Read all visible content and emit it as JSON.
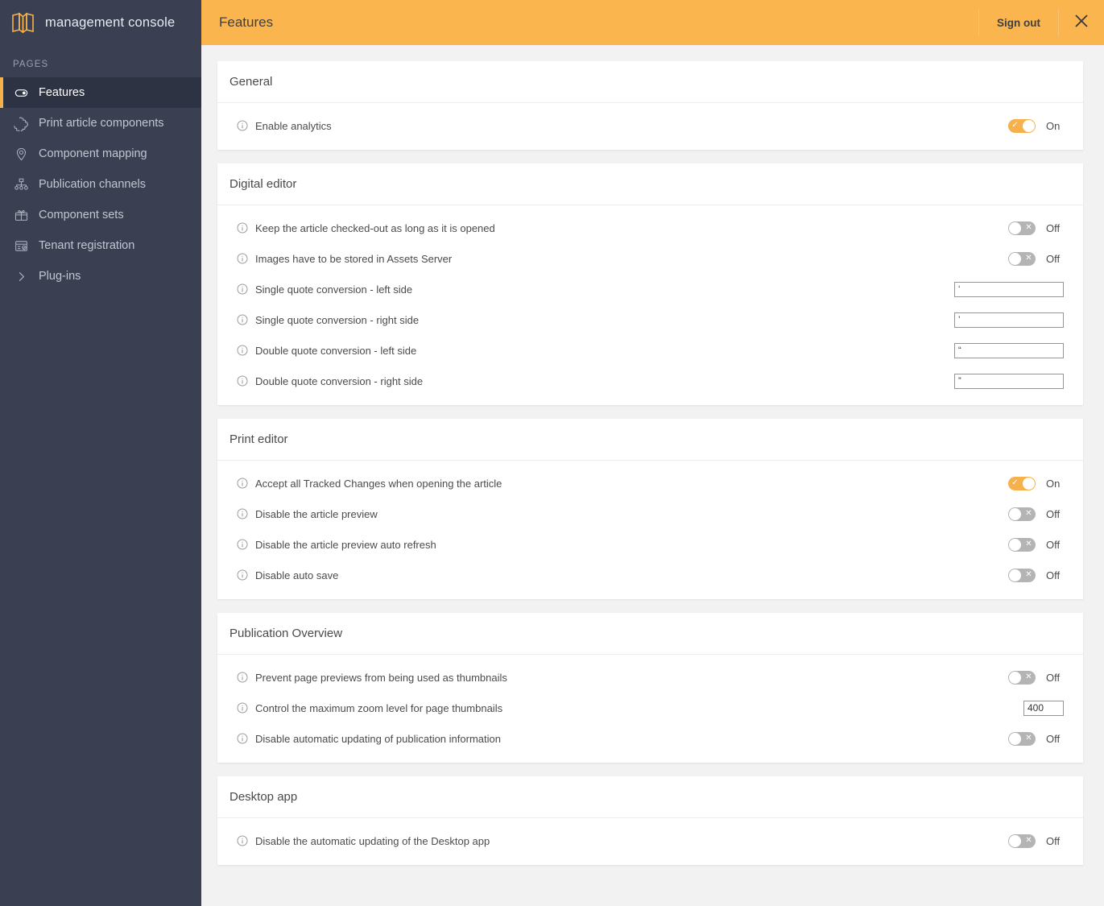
{
  "brand": {
    "title": "management console",
    "logo_icon": "book-logo-icon"
  },
  "sidebar": {
    "section_label": "PAGES",
    "items": [
      {
        "label": "Features",
        "icon": "toggle-icon",
        "active": true
      },
      {
        "label": "Print article components",
        "icon": "puzzle-icon",
        "active": false
      },
      {
        "label": "Component mapping",
        "icon": "map-pin-icon",
        "active": false
      },
      {
        "label": "Publication channels",
        "icon": "sitemap-icon",
        "active": false
      },
      {
        "label": "Component sets",
        "icon": "box-icon",
        "active": false
      },
      {
        "label": "Tenant registration",
        "icon": "registration-icon",
        "active": false
      },
      {
        "label": "Plug-ins",
        "icon": "chevron-right-icon",
        "active": false
      }
    ]
  },
  "topbar": {
    "title": "Features",
    "signout_label": "Sign out",
    "close_icon": "close-icon"
  },
  "colors": {
    "accent": "#fbb54f",
    "toggle_on": "#f7b14c",
    "toggle_off": "#b4b4b4",
    "sidebar_bg": "#3a4052",
    "sidebar_active_bg": "#2d3342",
    "page_bg": "#f2f2f2"
  },
  "states": {
    "on": "On",
    "off": "Off"
  },
  "sections": [
    {
      "title": "General",
      "rows": [
        {
          "label": "Enable analytics",
          "type": "toggle",
          "value": "On"
        }
      ]
    },
    {
      "title": "Digital editor",
      "rows": [
        {
          "label": "Keep the article checked-out as long as it is opened",
          "type": "toggle",
          "value": "Off"
        },
        {
          "label": "Images have to be stored in Assets Server",
          "type": "toggle",
          "value": "Off"
        },
        {
          "label": "Single quote conversion - left side",
          "type": "text",
          "value": "‘",
          "width": "wide"
        },
        {
          "label": "Single quote conversion - right side",
          "type": "text",
          "value": "’",
          "width": "wide"
        },
        {
          "label": "Double quote conversion - left side",
          "type": "text",
          "value": "“",
          "width": "wide"
        },
        {
          "label": "Double quote conversion - right side",
          "type": "text",
          "value": "”",
          "width": "wide"
        }
      ]
    },
    {
      "title": "Print editor",
      "rows": [
        {
          "label": "Accept all Tracked Changes when opening the article",
          "type": "toggle",
          "value": "On"
        },
        {
          "label": "Disable the article preview",
          "type": "toggle",
          "value": "Off"
        },
        {
          "label": "Disable the article preview auto refresh",
          "type": "toggle",
          "value": "Off"
        },
        {
          "label": "Disable auto save",
          "type": "toggle",
          "value": "Off"
        }
      ]
    },
    {
      "title": "Publication Overview",
      "rows": [
        {
          "label": "Prevent page previews from being used as thumbnails",
          "type": "toggle",
          "value": "Off"
        },
        {
          "label": "Control the maximum zoom level for page thumbnails",
          "type": "text",
          "value": "400",
          "width": "num"
        },
        {
          "label": "Disable automatic updating of publication information",
          "type": "toggle",
          "value": "Off"
        }
      ]
    },
    {
      "title": "Desktop app",
      "rows": [
        {
          "label": "Disable the automatic updating of the Desktop app",
          "type": "toggle",
          "value": "Off"
        }
      ]
    }
  ]
}
